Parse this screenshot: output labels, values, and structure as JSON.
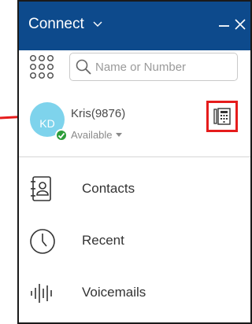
{
  "header": {
    "title": "Connect",
    "menu_icon": "chevron-down-icon",
    "minimize_icon": "minimize-icon",
    "close_icon": "close-icon",
    "background": "#0d4a8c"
  },
  "search": {
    "placeholder": "Name or Number",
    "value": "",
    "icon": "search-icon",
    "dialpad_icon": "dialpad-icon"
  },
  "profile": {
    "initials": "KD",
    "name": "Kris(9876)",
    "status": "Available",
    "status_color": "#2d9d3a",
    "avatar_color": "#7ed3ec",
    "highlight_button_icon": "phonebook-icon",
    "highlight_color": "#e51c1c"
  },
  "nav": {
    "items": [
      {
        "label": "Contacts",
        "icon": "contacts-icon"
      },
      {
        "label": "Recent",
        "icon": "clock-icon"
      },
      {
        "label": "Voicemails",
        "icon": "voicemail-icon"
      }
    ]
  }
}
